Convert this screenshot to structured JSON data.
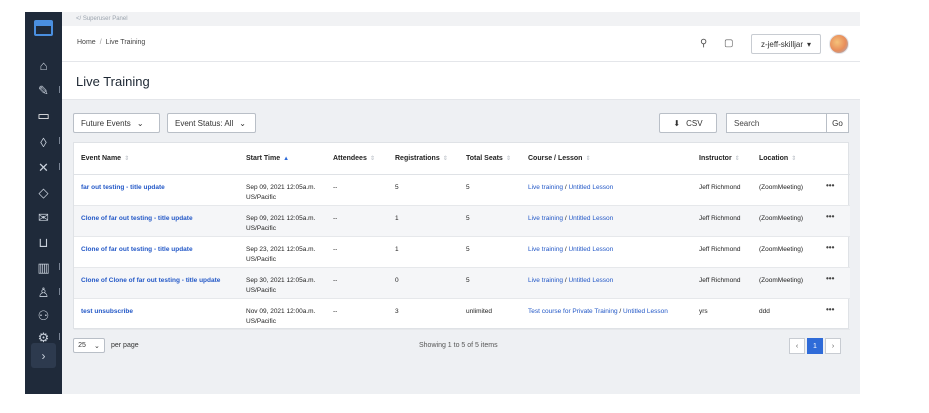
{
  "super_bar": "</ Superuser Panel",
  "breadcrumb": {
    "home": "Home",
    "separator": "/",
    "current": "Live Training"
  },
  "user": {
    "name": "z-jeff-skilljar",
    "caret": "▾"
  },
  "page_title": "Live Training",
  "filters": {
    "events": "Future Events",
    "status": "Event Status: All",
    "csv": "CSV",
    "search_placeholder": "Search",
    "go": "Go"
  },
  "table": {
    "headers": [
      "Event Name",
      "Start Time",
      "Attendees",
      "Registrations",
      "Total Seats",
      "Course / Lesson",
      "Instructor",
      "Location"
    ],
    "rows": [
      {
        "name": "far out testing - title update",
        "start": "Sep 09, 2021 12:05a.m.",
        "tz": "US/Pacific",
        "attendees": "--",
        "registrations": "5",
        "seats": "5",
        "course": "Live training",
        "lesson": "Untitled Lesson",
        "instructor": "Jeff Richmond",
        "location": "(ZoomMeeting)",
        "more": "•••"
      },
      {
        "name": "Clone of far out testing - title update",
        "start": "Sep 09, 2021 12:05a.m.",
        "tz": "US/Pacific",
        "attendees": "--",
        "registrations": "1",
        "seats": "5",
        "course": "Live training",
        "lesson": "Untitled Lesson",
        "instructor": "Jeff Richmond",
        "location": "(ZoomMeeting)",
        "more": "•••"
      },
      {
        "name": "Clone of far out testing - title update",
        "start": "Sep 23, 2021 12:05a.m.",
        "tz": "US/Pacific",
        "attendees": "--",
        "registrations": "1",
        "seats": "5",
        "course": "Live training",
        "lesson": "Untitled Lesson",
        "instructor": "Jeff Richmond",
        "location": "(ZoomMeeting)",
        "more": "•••"
      },
      {
        "name": "Clone of Clone of far out testing - title update",
        "start": "Sep 30, 2021 12:05a.m.",
        "tz": "US/Pacific",
        "attendees": "--",
        "registrations": "0",
        "seats": "5",
        "course": "Live training",
        "lesson": "Untitled Lesson",
        "instructor": "Jeff Richmond",
        "location": "(ZoomMeeting)",
        "more": "•••"
      },
      {
        "name": "test unsubscribe",
        "start": "Nov 09, 2021 12:00a.m.",
        "tz": "US/Pacific",
        "attendees": "--",
        "registrations": "3",
        "seats": "unlimited",
        "course": "Test course for Private Training",
        "lesson": "Untitled Lesson",
        "instructor": "yrs",
        "location": "ddd",
        "more": "•••"
      }
    ]
  },
  "pagination": {
    "per_page_value": "25",
    "per_page_label": "per page",
    "showing": "Showing 1 to 5 of 5 items",
    "prev": "‹",
    "current": "1",
    "next": "›"
  },
  "colors": {
    "sidebar": "#1f2a3a",
    "accent": "#2f6bd8",
    "link": "#2358c7"
  }
}
